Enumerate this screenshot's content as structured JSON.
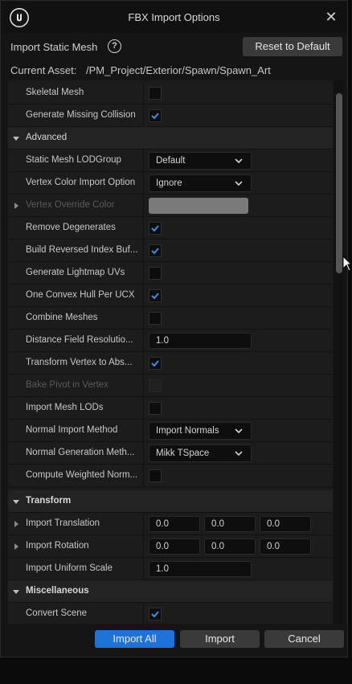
{
  "window": {
    "title": "FBX Import Options",
    "close_label": "✕"
  },
  "header": {
    "title": "Import Static Mesh",
    "help_label": "?",
    "reset_label": "Reset to Default"
  },
  "asset": {
    "label": "Current Asset:",
    "path": "/PM_Project/Exterior/Spawn/Spawn_Art"
  },
  "rows": {
    "skeletal_mesh": {
      "label": "Skeletal Mesh",
      "checked": false
    },
    "gen_missing_collision": {
      "label": "Generate Missing Collision",
      "checked": true
    },
    "advanced": {
      "label": "Advanced"
    },
    "lod_group": {
      "label": "Static Mesh LODGroup",
      "value": "Default"
    },
    "vertex_color_import": {
      "label": "Vertex Color Import Option",
      "value": "Ignore"
    },
    "vertex_override_color": {
      "label": "Vertex Override Color",
      "color": "#7a7a7a"
    },
    "remove_degenerates": {
      "label": "Remove Degenerates",
      "checked": true
    },
    "build_reversed_index": {
      "label": "Build Reversed Index Buf...",
      "checked": true
    },
    "gen_lightmap_uvs": {
      "label": "Generate Lightmap UVs",
      "checked": false
    },
    "one_convex_hull": {
      "label": "One Convex Hull Per UCX",
      "checked": true
    },
    "combine_meshes": {
      "label": "Combine Meshes",
      "checked": false
    },
    "distance_field": {
      "label": "Distance Field Resolutio...",
      "value": "1.0"
    },
    "transform_vertex": {
      "label": "Transform Vertex to Abs...",
      "checked": true
    },
    "bake_pivot": {
      "label": "Bake Pivot in Vertex",
      "checked": false
    },
    "import_mesh_lods": {
      "label": "Import Mesh LODs",
      "checked": false
    },
    "normal_import_method": {
      "label": "Normal Import Method",
      "value": "Import Normals"
    },
    "normal_gen_method": {
      "label": "Normal Generation Meth...",
      "value": "Mikk TSpace"
    },
    "compute_weighted_normals": {
      "label": "Compute Weighted Norm...",
      "checked": false
    },
    "transform": {
      "label": "Transform"
    },
    "import_translation": {
      "label": "Import Translation",
      "x": "0.0",
      "y": "0.0",
      "z": "0.0"
    },
    "import_rotation": {
      "label": "Import Rotation",
      "x": "0.0",
      "y": "0.0",
      "z": "0.0"
    },
    "import_uniform_scale": {
      "label": "Import Uniform Scale",
      "value": "1.0"
    },
    "miscellaneous": {
      "label": "Miscellaneous"
    },
    "convert_scene": {
      "label": "Convert Scene",
      "checked": true
    }
  },
  "footer": {
    "import_all_label": "Import All",
    "import_label": "Import",
    "cancel_label": "Cancel"
  },
  "colors": {
    "accent": "#1f73d6",
    "checkmark": "#3b8ce8"
  }
}
